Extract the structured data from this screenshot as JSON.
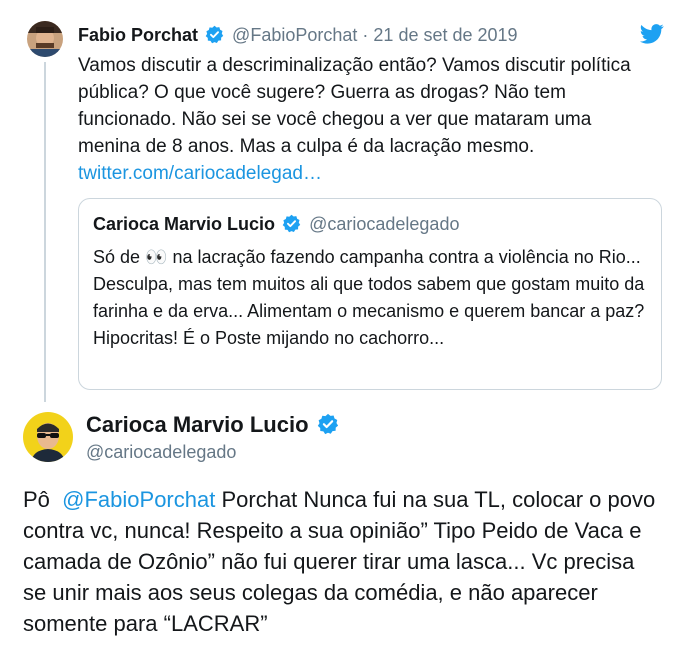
{
  "parent_tweet": {
    "author_name": "Fabio Porchat",
    "handle": "@FabioPorchat",
    "separator": "·",
    "date": "21 de set de 2019",
    "text": "Vamos discutir a descriminalização então? Vamos discutir política pública? O que você sugere? Guerra as drogas? Não tem funcionado. Não sei se você chegou a ver que mataram uma menina de 8 anos. Mas a culpa é da lacração mesmo.",
    "link": "twitter.com/cariocadelegad…",
    "quoted": {
      "author_name": "Carioca Marvio Lucio",
      "handle": "@cariocadelegado",
      "text_before_emoji": "Só de",
      "emoji": "👀",
      "text_after_emoji": "na lacração fazendo campanha contra a violência no Rio... Desculpa, mas tem muitos ali que todos sabem que gostam muito da farinha e da erva... Alimentam o mecanismo e querem bancar a paz? Hipocritas! É o Poste mijando no cachorro..."
    }
  },
  "reply_tweet": {
    "author_name": "Carioca Marvio Lucio",
    "handle": "@cariocadelegado",
    "text_prefix": "Pô",
    "mention": "@FabioPorchat",
    "text": "Porchat Nunca fui na sua TL, colocar o povo contra vc, nunca! Respeito a sua opinião” Tipo Peido de Vaca e camada de Ozônio” não fui querer tirar uma lasca... Vc precisa se unir mais aos seus colegas da comédia, e não aparecer somente para “LACRAR”"
  },
  "colors": {
    "link": "#1b95e0",
    "verified": "#1da1f2",
    "muted": "#657786",
    "border": "#ccd6dd"
  },
  "icons": [
    "twitter-bird-icon",
    "verified-badge-icon"
  ]
}
